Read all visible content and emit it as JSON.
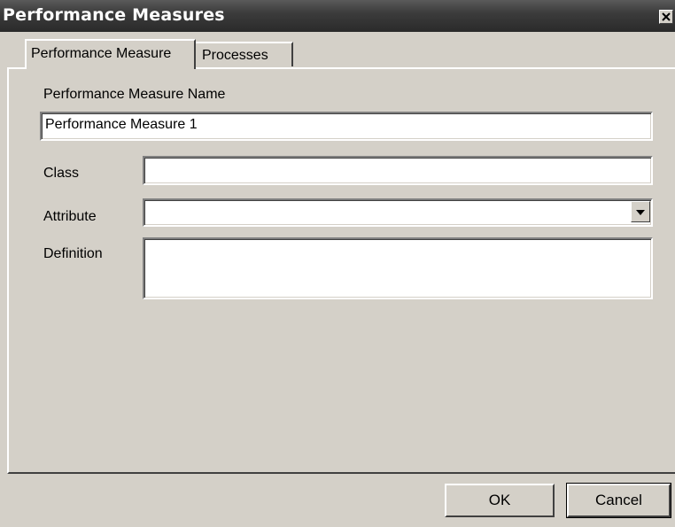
{
  "window": {
    "title": "Performance Measures"
  },
  "tabs": [
    {
      "label": "Performance Measure",
      "selected": true
    },
    {
      "label": "Processes",
      "selected": false
    }
  ],
  "form": {
    "name_label": "Performance Measure Name",
    "name_value": "Performance Measure 1",
    "class_label": "Class",
    "class_value": "",
    "attribute_label": "Attribute",
    "attribute_value": "",
    "definition_label": "Definition",
    "definition_value": ""
  },
  "buttons": {
    "ok_label": "OK",
    "cancel_label": "Cancel"
  },
  "icons": {
    "close": "close-icon",
    "dropdown": "chevron-down-icon"
  },
  "colors": {
    "dialog_face": "#d4d0c8",
    "title_bar": "#3c3c3c",
    "field_background": "#ffffff"
  }
}
